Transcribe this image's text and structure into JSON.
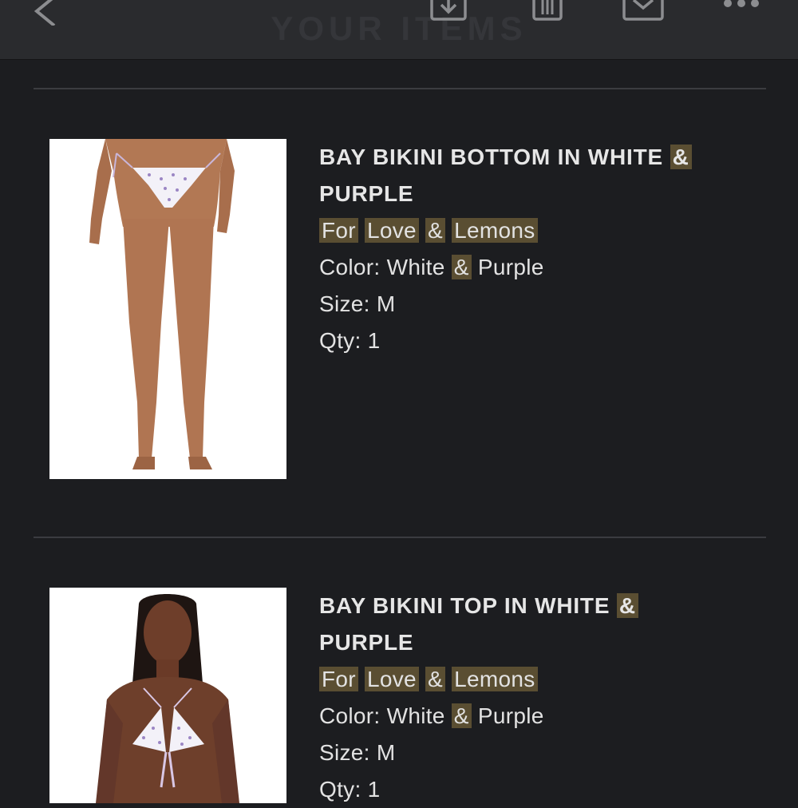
{
  "header": {
    "title": "YOUR ITEMS"
  },
  "toolbar": {
    "icons": [
      "back-icon",
      "download-icon",
      "trash-icon",
      "mail-icon",
      "more-icon"
    ]
  },
  "highlight_color": "#5a4e32",
  "background_color": "#1c1d20",
  "items": [
    {
      "title_pre": "BAY BIKINI BOTTOM IN WHITE",
      "title_amp": "&",
      "title_post": "PURPLE",
      "brand_for": "For",
      "brand_love": "Love",
      "brand_amp": "&",
      "brand_lemons": "Lemons",
      "color_label": "Color:",
      "color_white": "White",
      "color_amp": "&",
      "color_purple": "Purple",
      "size_label": "Size:",
      "size_value": "M",
      "qty_label": "Qty:",
      "qty_value": "1",
      "image_alt": "model wearing white and purple bikini bottom"
    },
    {
      "title_pre": "BAY BIKINI TOP IN WHITE",
      "title_amp": "&",
      "title_post": "PURPLE",
      "brand_for": "For",
      "brand_love": "Love",
      "brand_amp": "&",
      "brand_lemons": "Lemons",
      "color_label": "Color:",
      "color_white": "White",
      "color_amp": "&",
      "color_purple": "Purple",
      "size_label": "Size:",
      "size_value": "M",
      "qty_label": "Qty:",
      "qty_value": "1",
      "image_alt": "model wearing white and purple bikini top"
    }
  ]
}
